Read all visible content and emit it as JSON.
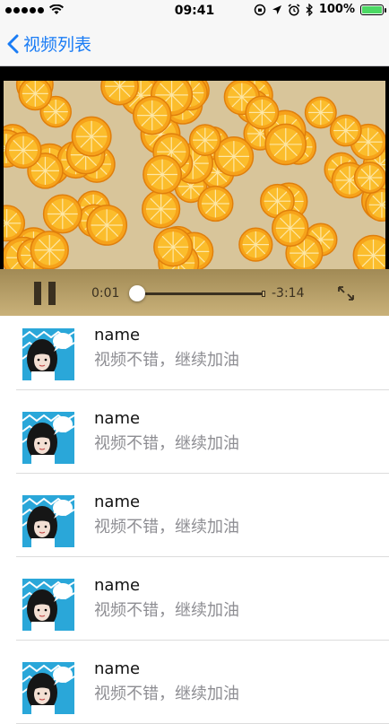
{
  "status_bar": {
    "time": "09:41",
    "battery_percent": "100%",
    "signal_bars": 5,
    "battery_level": 1.0,
    "battery_color": "#4cd964"
  },
  "nav": {
    "back_icon": "chevron-left-icon",
    "title": "视频列表",
    "accent_color": "#1a7cf5"
  },
  "player": {
    "state": "playing",
    "current_time": "0:01",
    "remaining_time": "-3:14",
    "progress": 0.005,
    "pause_icon": "pause-icon",
    "fullscreen_icon": "fullscreen-icon"
  },
  "comments": [
    {
      "name": "name",
      "text": "视频不错，继续加油"
    },
    {
      "name": "name",
      "text": "视频不错，继续加油"
    },
    {
      "name": "name",
      "text": "视频不错，继续加油"
    },
    {
      "name": "name",
      "text": "视频不错，继续加油"
    },
    {
      "name": "name",
      "text": "视频不错，继续加油"
    }
  ]
}
